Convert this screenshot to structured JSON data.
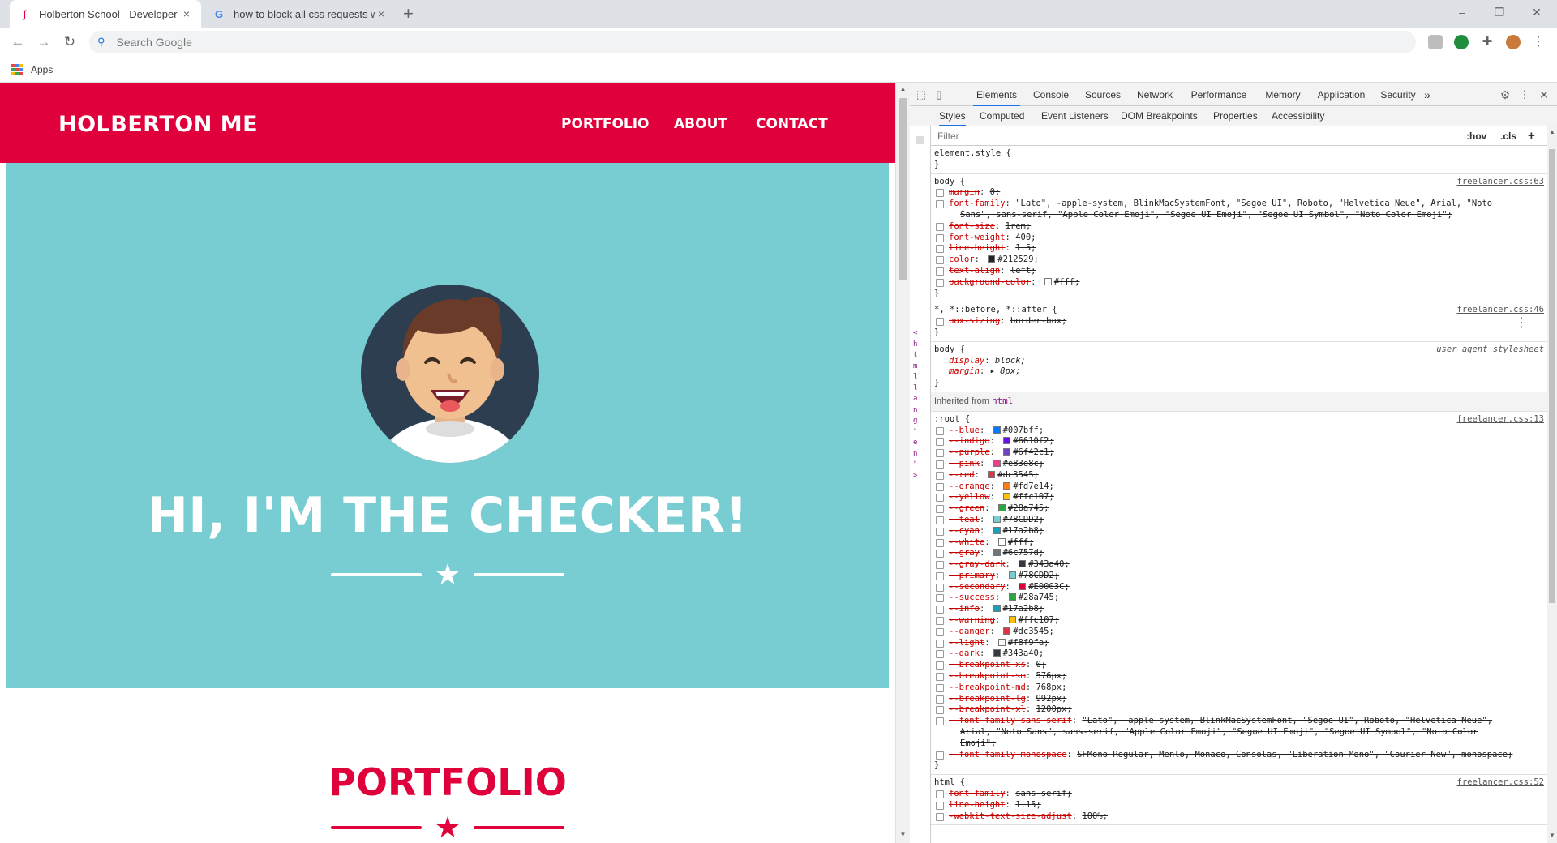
{
  "browser": {
    "tabs": [
      {
        "title": "Holberton School - Developer to",
        "close": "×",
        "favicon": "holberton"
      },
      {
        "title": "how to block all css requests with",
        "close": "×",
        "favicon": "G"
      }
    ],
    "new_tab": "+",
    "window_controls": {
      "minimize": "–",
      "restore": "❐",
      "close": "✕"
    },
    "nav": {
      "back": "←",
      "forward": "→",
      "reload": "↻"
    },
    "omnibox": {
      "search_icon": "🔍",
      "placeholder": "Search Google"
    },
    "bookmarks": {
      "apps_label": "Apps"
    }
  },
  "page": {
    "brand": "HOLBERTON ME",
    "nav_links": [
      "PORTFOLIO",
      "ABOUT",
      "CONTACT"
    ],
    "hero_heading": "HI, I'M THE CHECKER!",
    "section_heading": "PORTFOLIO",
    "colors": {
      "primary": "#e0003c",
      "masthead": "#78cdd2",
      "avatar_bg": "#2c3e50"
    }
  },
  "devtools": {
    "tabs": [
      "Elements",
      "Console",
      "Sources",
      "Network",
      "Performance",
      "Memory",
      "Application",
      "Security"
    ],
    "more_tabs": "»",
    "subtabs": [
      "Styles",
      "Computed",
      "Event Listeners",
      "DOM Breakpoints",
      "Properties",
      "Accessibility"
    ],
    "filter_placeholder": "Filter",
    "hov": ":hov",
    "cls": ".cls",
    "add": "+",
    "gutter_chars": [
      "<",
      "h",
      "t",
      "m",
      "l",
      "l",
      "a",
      "n",
      "g",
      "\"",
      "e",
      "n",
      "\"",
      ">"
    ],
    "rules": [
      {
        "selector": "element.style {",
        "source": "",
        "close": "}",
        "decls": []
      },
      {
        "selector": "body {",
        "source": "freelancer.css:63",
        "close": "}",
        "decls": [
          {
            "prop": "margin",
            "val": "0;",
            "crossed": true
          },
          {
            "prop": "font-family",
            "val": "\"Lato\", -apple-system, BlinkMacSystemFont, \"Segoe UI\", Roboto, \"Helvetica Neue\", Arial, \"Noto",
            "crossed": true
          },
          {
            "prop": "",
            "val": "Sans\", sans-serif, \"Apple Color Emoji\", \"Segoe UI Emoji\", \"Segoe UI Symbol\", \"Noto Color Emoji\";",
            "crossed": true,
            "cont": true
          },
          {
            "prop": "font-size",
            "val": "1rem;",
            "crossed": true
          },
          {
            "prop": "font-weight",
            "val": "400;",
            "crossed": true
          },
          {
            "prop": "line-height",
            "val": "1.5;",
            "crossed": true
          },
          {
            "prop": "color",
            "val": "#212529;",
            "crossed": true,
            "swatch": "#212529"
          },
          {
            "prop": "text-align",
            "val": "left;",
            "crossed": true
          },
          {
            "prop": "background-color",
            "val": "#fff;",
            "crossed": true,
            "swatch": "#ffffff"
          }
        ]
      },
      {
        "selector": "*, *::before, *::after {",
        "source": "freelancer.css:46",
        "close": "}",
        "decls": [
          {
            "prop": "box-sizing",
            "val": "border-box;",
            "crossed": true
          }
        ]
      },
      {
        "selector": "body {",
        "source": "user agent stylesheet",
        "ua": true,
        "close": "}",
        "decls": [
          {
            "prop": "display",
            "val": "block;",
            "crossed": false,
            "ua": true
          },
          {
            "prop": "margin",
            "val": "▸ 8px;",
            "crossed": false,
            "ua": true
          }
        ]
      }
    ],
    "inherited_label": "Inherited from",
    "inherited_tag": "html",
    "root_rule": {
      "selector": ":root {",
      "source": "freelancer.css:13",
      "close": "}",
      "decls": [
        {
          "prop": "--blue",
          "val": "#007bff;",
          "swatch": "#007bff"
        },
        {
          "prop": "--indigo",
          "val": "#6610f2;",
          "swatch": "#6610f2"
        },
        {
          "prop": "--purple",
          "val": "#6f42c1;",
          "swatch": "#6f42c1"
        },
        {
          "prop": "--pink",
          "val": "#e83e8c;",
          "swatch": "#e83e8c"
        },
        {
          "prop": "--red",
          "val": "#dc3545;",
          "swatch": "#dc3545"
        },
        {
          "prop": "--orange",
          "val": "#fd7e14;",
          "swatch": "#fd7e14"
        },
        {
          "prop": "--yellow",
          "val": "#ffc107;",
          "swatch": "#ffc107"
        },
        {
          "prop": "--green",
          "val": "#28a745;",
          "swatch": "#28a745"
        },
        {
          "prop": "--teal",
          "val": "#78CDD2;",
          "swatch": "#78cdd2"
        },
        {
          "prop": "--cyan",
          "val": "#17a2b8;",
          "swatch": "#17a2b8"
        },
        {
          "prop": "--white",
          "val": "#fff;",
          "swatch": "#ffffff"
        },
        {
          "prop": "--gray",
          "val": "#6c757d;",
          "swatch": "#6c757d"
        },
        {
          "prop": "--gray-dark",
          "val": "#343a40;",
          "swatch": "#343a40"
        },
        {
          "prop": "--primary",
          "val": "#78CDD2;",
          "swatch": "#78cdd2"
        },
        {
          "prop": "--secondary",
          "val": "#E0003C;",
          "swatch": "#e0003c"
        },
        {
          "prop": "--success",
          "val": "#28a745;",
          "swatch": "#28a745"
        },
        {
          "prop": "--info",
          "val": "#17a2b8;",
          "swatch": "#17a2b8"
        },
        {
          "prop": "--warning",
          "val": "#ffc107;",
          "swatch": "#ffc107"
        },
        {
          "prop": "--danger",
          "val": "#dc3545;",
          "swatch": "#dc3545"
        },
        {
          "prop": "--light",
          "val": "#f8f9fa;",
          "swatch": "#f8f9fa"
        },
        {
          "prop": "--dark",
          "val": "#343a40;",
          "swatch": "#343a40"
        },
        {
          "prop": "--breakpoint-xs",
          "val": "0;"
        },
        {
          "prop": "--breakpoint-sm",
          "val": "576px;"
        },
        {
          "prop": "--breakpoint-md",
          "val": "768px;"
        },
        {
          "prop": "--breakpoint-lg",
          "val": "992px;"
        },
        {
          "prop": "--breakpoint-xl",
          "val": "1200px;"
        },
        {
          "prop": "--font-family-sans-serif",
          "val": "\"Lato\", -apple-system, BlinkMacSystemFont, \"Segoe UI\", Roboto, \"Helvetica Neue\","
        },
        {
          "prop": "",
          "val": "Arial, \"Noto Sans\", sans-serif, \"Apple Color Emoji\", \"Segoe UI Emoji\", \"Segoe UI Symbol\", \"Noto Color",
          "cont": true
        },
        {
          "prop": "",
          "val": "Emoji\";",
          "cont": true
        },
        {
          "prop": "--font-family-monospace",
          "val": "SFMono-Regular, Menlo, Monaco, Consolas, \"Liberation Mono\", \"Courier New\", monospace;"
        }
      ]
    },
    "html_rule": {
      "selector": "html {",
      "source": "freelancer.css:52",
      "decls": [
        {
          "prop": "font-family",
          "val": "sans-serif;"
        },
        {
          "prop": "line-height",
          "val": "1.15;"
        },
        {
          "prop": "-webkit-text-size-adjust",
          "val": "100%;"
        }
      ]
    }
  }
}
